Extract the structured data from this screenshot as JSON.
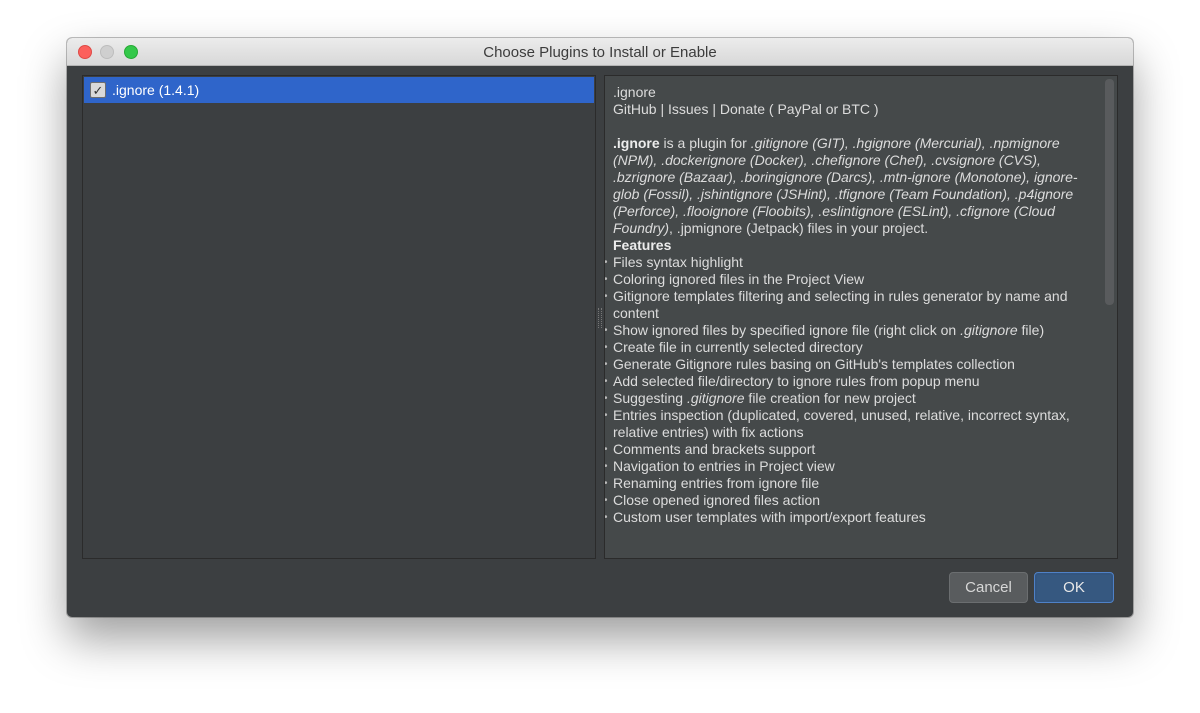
{
  "window": {
    "title": "Choose Plugins to Install or Enable"
  },
  "plugins": [
    {
      "label": ".ignore (1.4.1)",
      "checked": true
    }
  ],
  "description": {
    "name": ".ignore",
    "links": "GitHub | Issues | Donate ( PayPal or BTC )",
    "intro_bold": ".ignore",
    "intro_segments": [
      {
        "t": " is a plugin for ",
        "s": "n"
      },
      {
        "t": ".gitignore (GIT), .hgignore (Mercurial), .npmignore (NPM), .dockerignore (Docker), .chefignore (Chef), .cvsignore (CVS), .bzrignore (Bazaar), .boringignore (Darcs), .mtn-ignore (Monotone), ignore-glob (Fossil), .jshintignore (JSHint), .tfignore (Team Foundation), .p4ignore (Perforce), .flooignore (Floobits), .eslintignore (ESLint), .cfignore (Cloud Foundry)",
        "s": "i"
      },
      {
        "t": ", .jpmignore (Jetpack) files in your project.",
        "s": "n"
      }
    ],
    "features_heading": "Features",
    "features": [
      {
        "a": "Files syntax highlight"
      },
      {
        "a": "Coloring ignored files in the Project View"
      },
      {
        "a": "Gitignore templates filtering and selecting in rules generator by name and content"
      },
      {
        "a": "Show ignored files by specified ignore file (right click on ",
        "i": ".gitignore",
        "b": " file)"
      },
      {
        "a": "Create file in currently selected directory"
      },
      {
        "a": "Generate Gitignore rules basing on GitHub's templates collection"
      },
      {
        "a": "Add selected file/directory to ignore rules from popup menu"
      },
      {
        "a": "Suggesting ",
        "i": ".gitignore",
        "b": " file creation for new project"
      },
      {
        "a": "Entries inspection (duplicated, covered, unused, relative, incorrect syntax, relative entries) with fix actions"
      },
      {
        "a": "Comments and brackets support"
      },
      {
        "a": "Navigation to entries in Project view"
      },
      {
        "a": "Renaming entries from ignore file"
      },
      {
        "a": "Close opened ignored files action"
      },
      {
        "a": "Custom user templates with import/export features"
      }
    ]
  },
  "buttons": {
    "cancel": "Cancel",
    "ok": "OK"
  },
  "icons": {
    "checkbox_checked": "✓"
  },
  "colors": {
    "selection": "#2f65ca",
    "dialog_bg": "#3c3f41",
    "default_button": "#365880"
  }
}
